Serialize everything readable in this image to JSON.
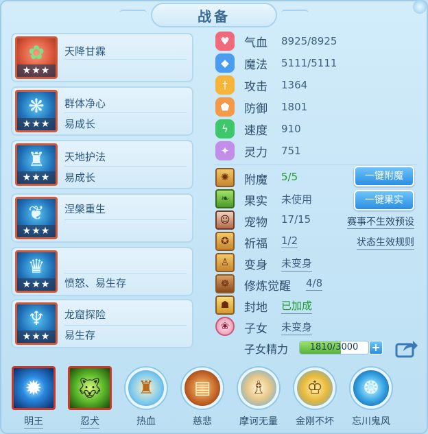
{
  "title": "战备",
  "skills": [
    {
      "name": "天降甘霖",
      "sub": "",
      "stars": "★★★",
      "icon": "popsicle-icon"
    },
    {
      "name": "群体净心",
      "sub": "易成长",
      "stars": "★★★",
      "icon": "blue-feather-icon"
    },
    {
      "name": "天地护法",
      "sub": "易成长",
      "stars": "★★★",
      "icon": "guardian-icon"
    },
    {
      "name": "涅槃重生",
      "sub": "",
      "stars": "★★★",
      "icon": "phoenix-icon"
    },
    {
      "name": "",
      "sub": "愤怒、易生存",
      "stars": "★★★",
      "icon": "crown-icon"
    },
    {
      "name": "龙窟探险",
      "sub": "易生存",
      "stars": "★★★",
      "icon": "dragon-helm-icon"
    }
  ],
  "stats": [
    {
      "label": "气血",
      "value": "8925/8925",
      "icon": "heart-icon",
      "color": "#f06a7c"
    },
    {
      "label": "魔法",
      "value": "5111/5111",
      "icon": "mana-icon",
      "color": "#4a9cf0"
    },
    {
      "label": "攻击",
      "value": "1364",
      "icon": "sword-icon",
      "color": "#f4b53a"
    },
    {
      "label": "防御",
      "value": "1801",
      "icon": "shield-icon",
      "color": "#f39a4a"
    },
    {
      "label": "速度",
      "value": "910",
      "icon": "lightning-icon",
      "color": "#3ec86a"
    },
    {
      "label": "灵力",
      "value": "751",
      "icon": "spirit-icon",
      "color": "#c28ee8"
    }
  ],
  "attrs": {
    "enchant": {
      "label": "附魔",
      "value": "5/5"
    },
    "fruit": {
      "label": "果实",
      "value": "未使用"
    },
    "pet": {
      "label": "宠物",
      "value": "17/15"
    },
    "blessing": {
      "label": "祈福",
      "value": "1/2"
    },
    "transform": {
      "label": "变身",
      "value": "未变身"
    },
    "awaken": {
      "label": "修炼觉醒",
      "value": "4/8"
    },
    "seal": {
      "label": "封地",
      "value": "已加成"
    },
    "child": {
      "label": "子女",
      "value": "未变身"
    }
  },
  "buttons": {
    "enchant": "一键附魔",
    "fruit": "一键果实"
  },
  "links": {
    "preset": "赛事不生效预设",
    "rules": "状态生效规则"
  },
  "essence": {
    "label": "子女精力",
    "text": "1810/3000",
    "fraction": 0.603,
    "plus": "+"
  },
  "bottom": [
    {
      "label": "明王",
      "icon": "orb-icon"
    },
    {
      "label": "忍犬",
      "icon": "dog-icon"
    },
    {
      "label": "热血",
      "icon": "monk-icon"
    },
    {
      "label": "慈悲",
      "icon": "scroll-icon"
    },
    {
      "label": "摩诃无量",
      "icon": "sage-icon"
    },
    {
      "label": "金刚不坏",
      "icon": "golden-warrior-icon"
    },
    {
      "label": "忘川鬼风",
      "icon": "spirit-wind-icon"
    }
  ]
}
